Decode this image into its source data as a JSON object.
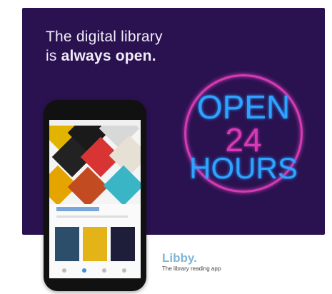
{
  "banner": {
    "line1": "The digital library",
    "line2_prefix": "is ",
    "line2_bold": "always open.",
    "sign_open": "OPEN",
    "sign_24": "24",
    "sign_hours": "HOURS"
  },
  "libby": {
    "brand": "Libby.",
    "tagline": "The library reading app"
  },
  "colors": {
    "banner_bg": "#2a1250",
    "neon_blue": "#2ea3ff",
    "neon_pink": "#d63bb5",
    "brand": "#7fb6d8"
  }
}
